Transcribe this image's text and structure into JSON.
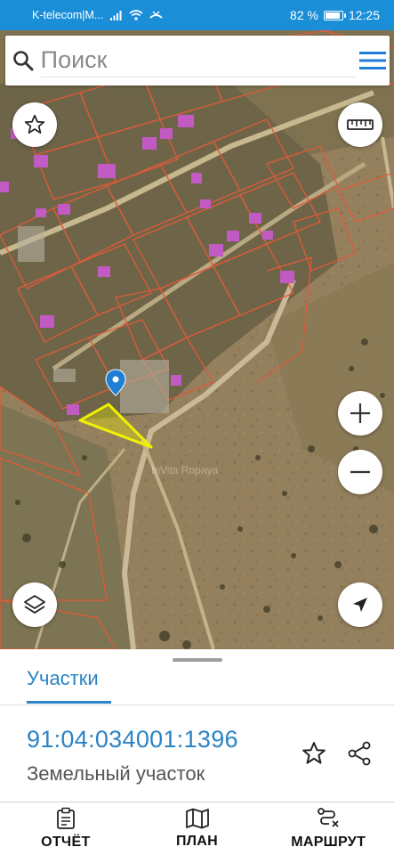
{
  "status_bar": {
    "carrier": "K-telecom|M...",
    "battery_label": "82 %",
    "battery_level": 0.82,
    "time": "12:25"
  },
  "search": {
    "placeholder": "Поиск"
  },
  "map": {
    "watermark": "InVita Ropaya",
    "icons": {
      "favorite": "star-icon",
      "ruler": "ruler-icon",
      "zoom_in": "plus-icon",
      "zoom_out": "minus-icon",
      "layers": "layers-icon",
      "locate": "navigation-arrow-icon",
      "marker": "map-pin-icon"
    },
    "parcel_outline_color": "#e05a3a",
    "selected_parcel_color": "#f2f200",
    "building_color": "#c25ac4"
  },
  "sheet": {
    "tab_label": "Участки",
    "cadastral_number": "91:04:034001:1396",
    "parcel_type": "Земельный участок",
    "accent_color": "#2a84c6"
  },
  "bottom_nav": {
    "items": [
      {
        "label": "ОТЧЁТ",
        "icon": "report-clipboard-icon"
      },
      {
        "label": "ПЛАН",
        "icon": "map-plan-icon"
      },
      {
        "label": "МАРШРУТ",
        "icon": "route-icon"
      }
    ]
  }
}
